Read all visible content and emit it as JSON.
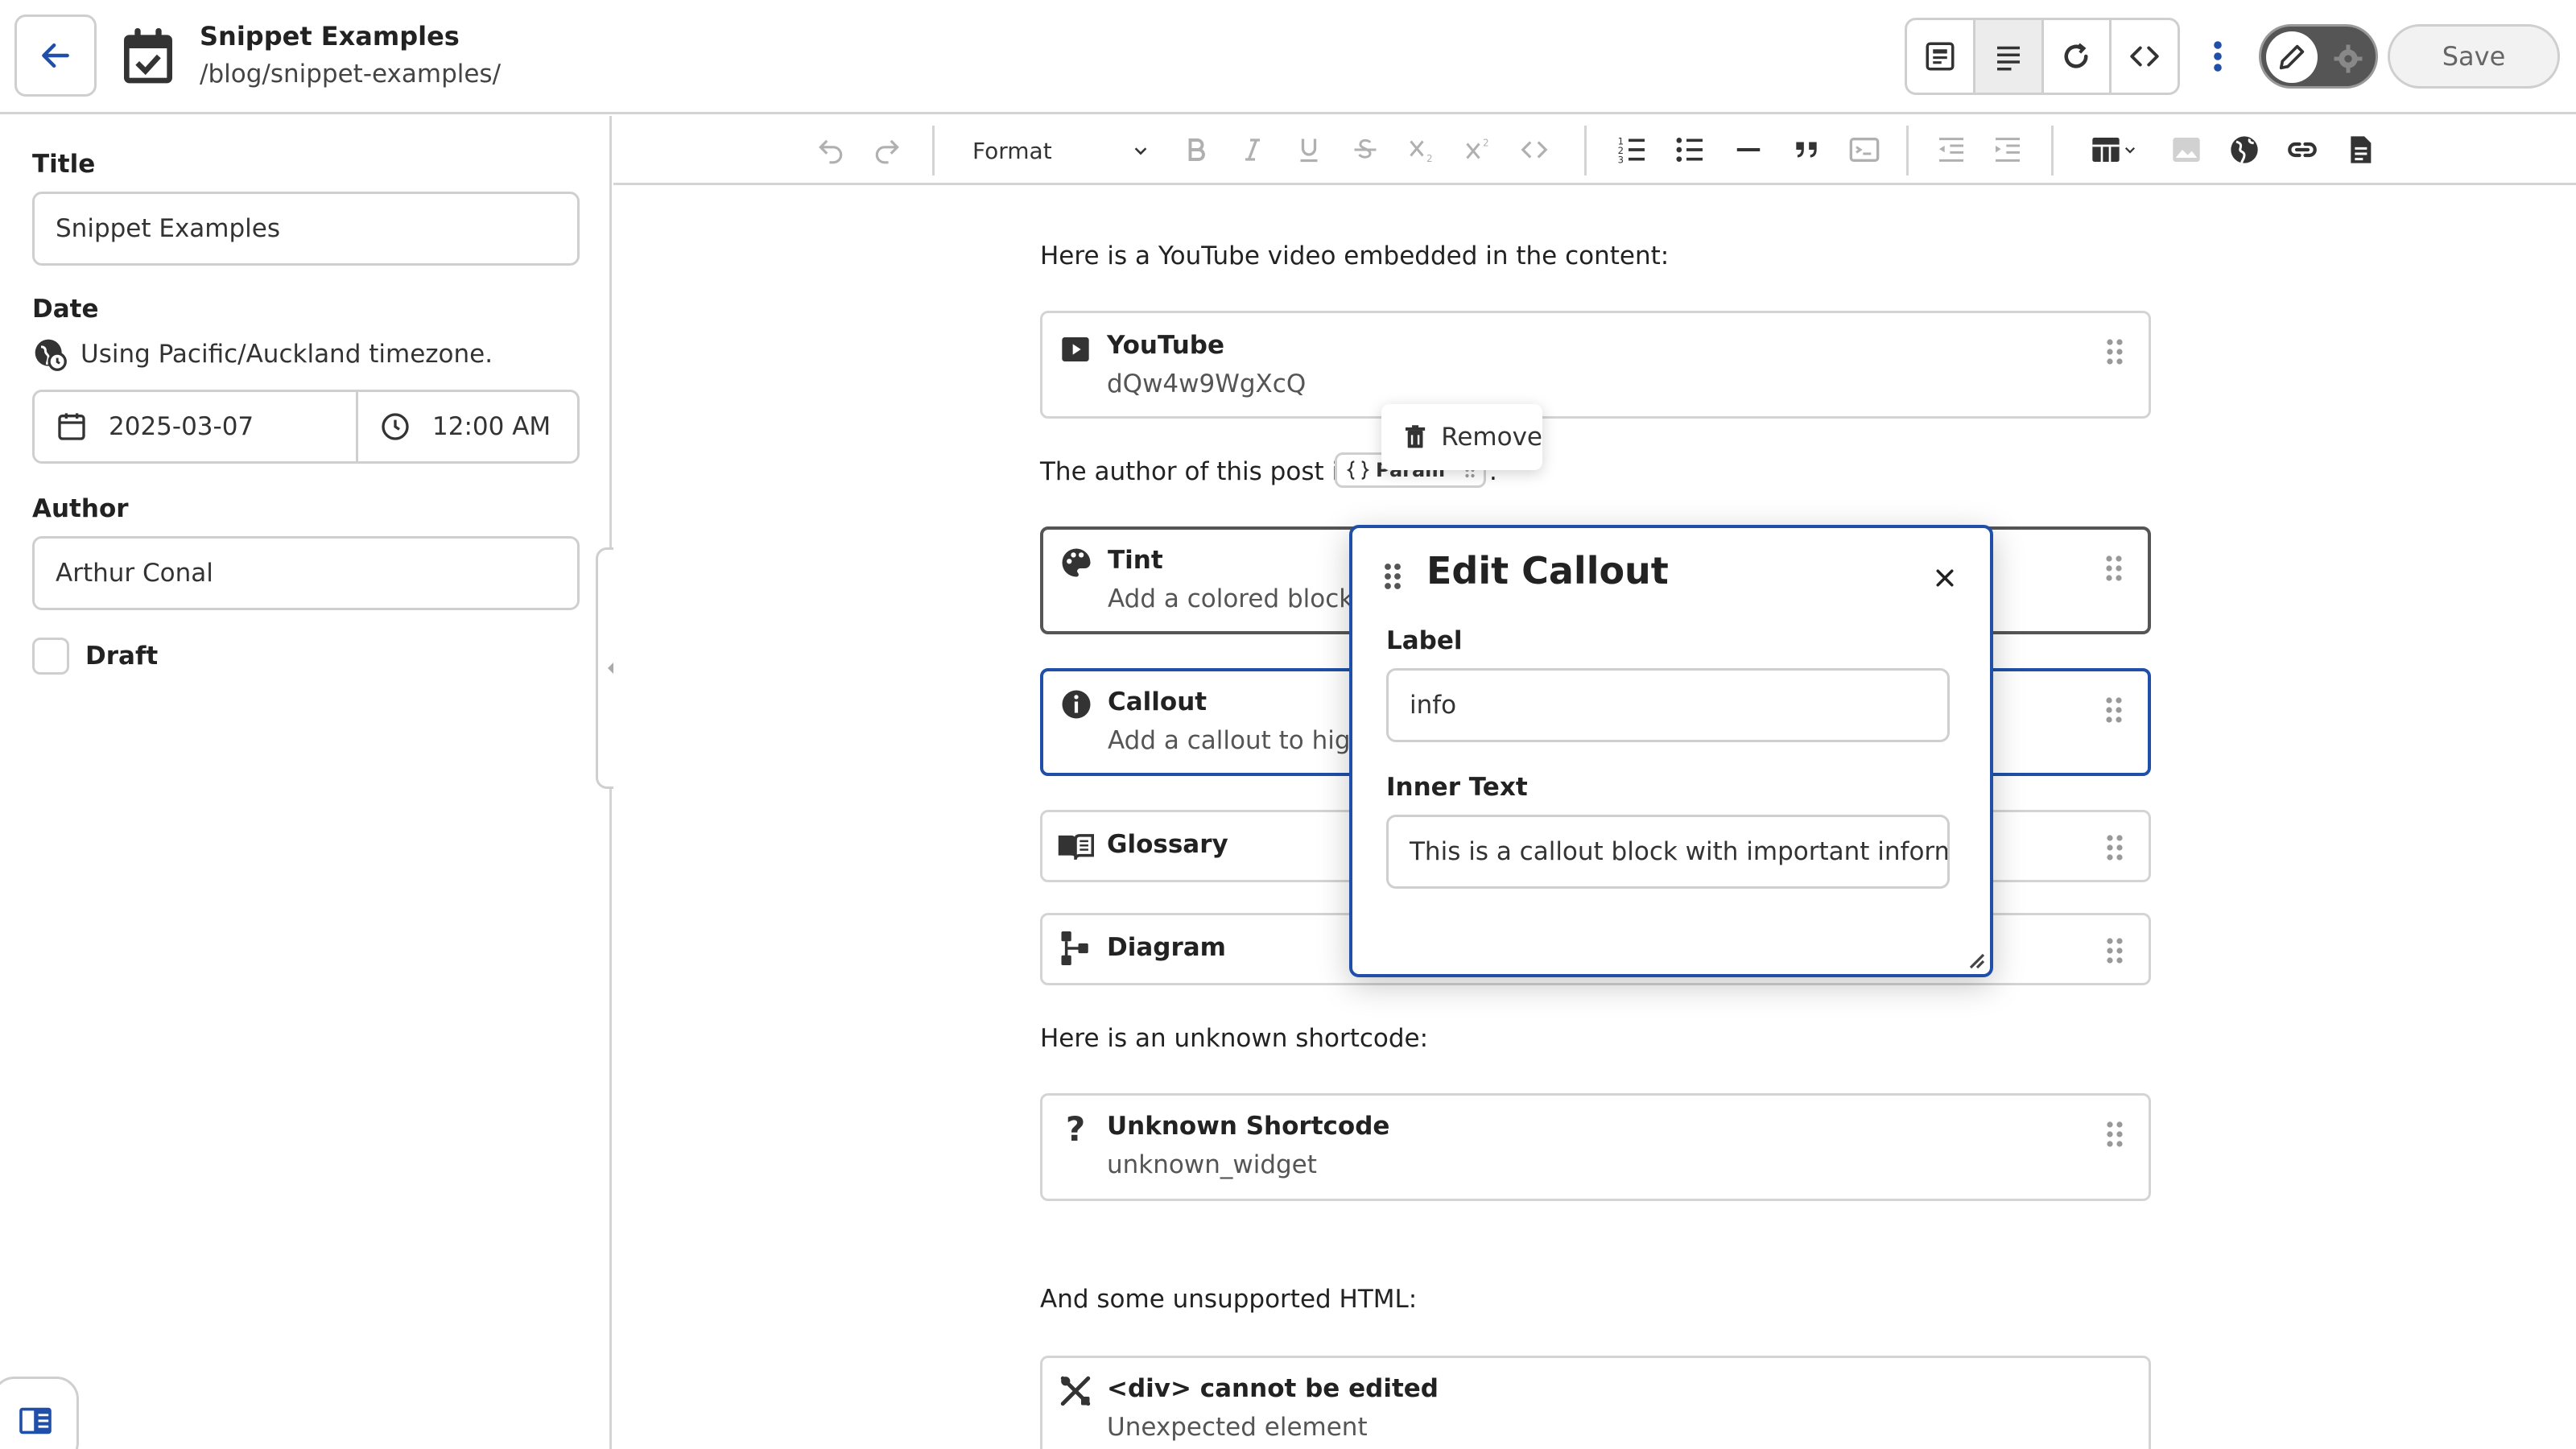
{
  "header": {
    "title": "Snippet Examples",
    "path": "/blog/snippet-examples/",
    "save_label": "Save"
  },
  "sidebar": {
    "title_label": "Title",
    "title_value": "Snippet Examples",
    "date_label": "Date",
    "timezone_note": "Using Pacific/Auckland timezone.",
    "date_value": "2025-03-07",
    "time_value": "12:00 AM",
    "author_label": "Author",
    "author_value": "Arthur Conal",
    "draft_label": "Draft"
  },
  "toolbar": {
    "format_label": "Format"
  },
  "editor": {
    "para_youtube": "Here is a YouTube video embedded in the content:",
    "youtube_title": "YouTube",
    "youtube_id": "dQw4w9WgXcQ",
    "para_author": "The author of this post is",
    "para_author_end": ".",
    "param_label": "Param",
    "tint_title": "Tint",
    "tint_desc": "Add a colored block c",
    "callout_title": "Callout",
    "callout_desc": "Add a callout to high",
    "glossary_title": "Glossary",
    "diagram_title": "Diagram",
    "para_unknown": "Here is an unknown shortcode:",
    "unknown_title": "Unknown Shortcode",
    "unknown_sub": "unknown_widget",
    "para_html": "And some unsupported HTML:",
    "html_title": "<div> cannot be edited",
    "html_sub": "Unexpected element"
  },
  "remove": {
    "label": "Remove"
  },
  "dialog": {
    "title": "Edit Callout",
    "label_field": "Label",
    "label_value": "info",
    "inner_field": "Inner Text",
    "inner_value": "This is a callout block with important informa"
  },
  "colors": {
    "accent": "#1f4fa8",
    "border": "#cfcfcf",
    "back_arrow": "#1f4fa8"
  }
}
